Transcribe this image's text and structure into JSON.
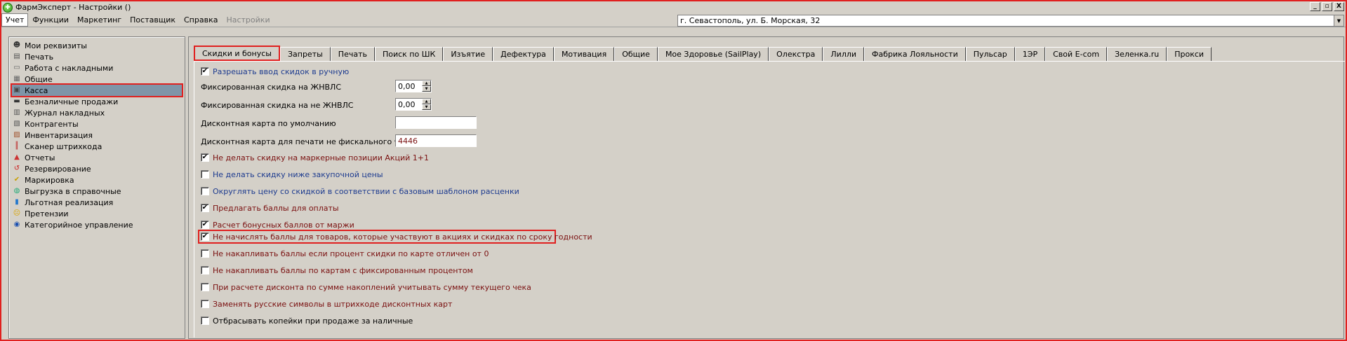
{
  "window": {
    "title": "ФармЭксперт - Настройки ()",
    "buttons": [
      "_",
      "▫",
      "X"
    ]
  },
  "menu": {
    "items": [
      {
        "label": "Учет",
        "state": "active"
      },
      {
        "label": "Функции",
        "state": "normal"
      },
      {
        "label": "Маркетинг",
        "state": "normal"
      },
      {
        "label": "Поставщик",
        "state": "normal"
      },
      {
        "label": "Справка",
        "state": "normal"
      },
      {
        "label": "Настройки",
        "state": "disabled"
      }
    ],
    "address": "г. Севастополь, ул. Б. Морская, 32"
  },
  "sidebar": {
    "items": [
      {
        "label": "Мои реквизиты",
        "icon": "user-icon"
      },
      {
        "label": "Печать",
        "icon": "printer-icon"
      },
      {
        "label": "Работа с накладными",
        "icon": "document-icon"
      },
      {
        "label": "Общие",
        "icon": "settings-icon"
      },
      {
        "label": "Касса",
        "icon": "cash-register-icon",
        "selected": true
      },
      {
        "label": "Безналичные продажи",
        "icon": "card-icon"
      },
      {
        "label": "Журнал накладных",
        "icon": "journal-icon"
      },
      {
        "label": "Контрагенты",
        "icon": "contacts-icon"
      },
      {
        "label": "Инвентаризация",
        "icon": "inventory-icon"
      },
      {
        "label": "Сканер штрихкода",
        "icon": "barcode-icon"
      },
      {
        "label": "Отчеты",
        "icon": "report-icon"
      },
      {
        "label": "Резервирование",
        "icon": "reserve-icon"
      },
      {
        "label": "Маркировка",
        "icon": "marking-icon"
      },
      {
        "label": "Выгрузка в справочные",
        "icon": "globe-icon"
      },
      {
        "label": "Льготная реализация",
        "icon": "discount-icon"
      },
      {
        "label": "Претензии",
        "icon": "complaint-icon"
      },
      {
        "label": "Категорийное управление",
        "icon": "category-icon"
      }
    ]
  },
  "tabs": [
    {
      "label": "Скидки и бонусы",
      "active": true
    },
    {
      "label": "Запреты"
    },
    {
      "label": "Печать"
    },
    {
      "label": "Поиск по ШК"
    },
    {
      "label": "Изъятие"
    },
    {
      "label": "Дефектура"
    },
    {
      "label": "Мотивация"
    },
    {
      "label": "Общие"
    },
    {
      "label": "Мое Здоровье (SailPlay)"
    },
    {
      "label": "Олекстра"
    },
    {
      "label": "Лилли"
    },
    {
      "label": "Фабрика Лояльности"
    },
    {
      "label": "Пульсар"
    },
    {
      "label": "1ЭР"
    },
    {
      "label": "Свой E-com"
    },
    {
      "label": "Зеленка.ru"
    },
    {
      "label": "Прокси"
    }
  ],
  "panel": {
    "allow_manual": {
      "label": "Разрешать ввод скидок в ручную",
      "checked": true
    },
    "fixed_jnvls": {
      "label": "Фиксированная скидка на ЖНВЛС",
      "value": "0,00"
    },
    "fixed_non_jnvls": {
      "label": "Фиксированная скидка на не ЖНВЛС",
      "value": "0,00"
    },
    "default_card": {
      "label": "Дисконтная карта по умолчанию",
      "value": ""
    },
    "nonfiscal_card": {
      "label": "Дисконтная карта для печати не фискального чека",
      "value": "4446"
    },
    "checkboxes": [
      {
        "label": "Не делать скидку на маркерные позиции Акций 1+1",
        "checked": true,
        "color": "red"
      },
      {
        "label": "Не делать скидку ниже закупочной цены",
        "checked": false,
        "color": "blue"
      },
      {
        "label": "Округлять цену со скидкой в соответствии с базовым шаблоном расценки",
        "checked": false,
        "color": "blue"
      },
      {
        "label": "Предлагать баллы для оплаты",
        "checked": true,
        "color": "red"
      },
      {
        "label": "Расчет бонусных баллов от маржи",
        "checked": true,
        "color": "red"
      },
      {
        "label": "Не начислять баллы для товаров, которые участвуют в акциях и скидках по сроку годности",
        "checked": true,
        "color": "red",
        "highlighted": true
      },
      {
        "label": "Не накапливать баллы если процент скидки по карте отличен от 0",
        "checked": false,
        "color": "red"
      },
      {
        "label": "Не накапливать баллы по картам с фиксированным процентом",
        "checked": false,
        "color": "red"
      },
      {
        "label": "При расчете дисконта по сумме накоплений учитывать сумму текущего чека",
        "checked": false,
        "color": "red"
      },
      {
        "label": "Заменять русские символы в штрихкоде дисконтных карт",
        "checked": false,
        "color": "red"
      },
      {
        "label": "Отбрасывать копейки при продаже за наличные",
        "checked": false,
        "color": "black"
      }
    ]
  }
}
